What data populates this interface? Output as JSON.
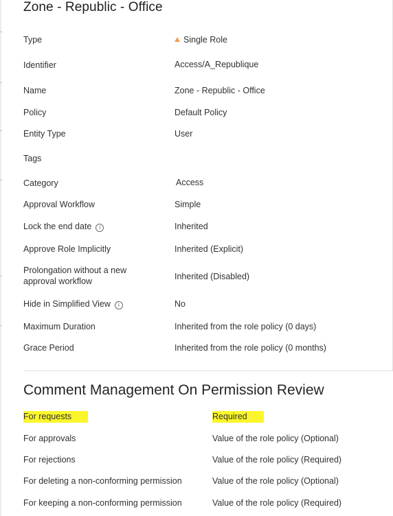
{
  "title": "Zone - Republic - Office",
  "properties": [
    {
      "label": "Type",
      "value": "Single Role"
    },
    {
      "label": "Identifier",
      "value": "Access/A_Republique"
    },
    {
      "label": "Name",
      "value": "Zone - Republic - Office"
    },
    {
      "label": "Policy",
      "value": "Default Policy"
    },
    {
      "label": "Entity Type",
      "value": "User"
    },
    {
      "label": "Tags",
      "value": ""
    },
    {
      "label": "Category",
      "value": "Access"
    },
    {
      "label": "Approval Workflow",
      "value": "Simple"
    },
    {
      "label": "Lock the end date",
      "value": "Inherited"
    },
    {
      "label": "Approve Role Implicitly",
      "value": "Inherited (Explicit)"
    },
    {
      "label": "Prolongation without a new approval workflow",
      "value": "Inherited (Disabled)"
    },
    {
      "label": "Hide in Simplified View",
      "value": "No"
    },
    {
      "label": "Maximum Duration",
      "value": "Inherited from the role policy (0 days)"
    },
    {
      "label": "Grace Period",
      "value": "Inherited from the role policy (0 months)"
    }
  ],
  "comments": {
    "title": "Comment Management On Permission Review",
    "rows": [
      {
        "label": "For requests",
        "value": "Required"
      },
      {
        "label": "For approvals",
        "value": "Value of the role policy (Optional)"
      },
      {
        "label": "For rejections",
        "value": "Value of the role policy (Required)"
      },
      {
        "label": "For deleting a non-conforming permission",
        "value": "Value of the role policy (Optional)"
      },
      {
        "label": "For keeping a non-conforming permission",
        "value": "Value of the role policy (Required)"
      }
    ]
  },
  "colors": {
    "highlight": "#fbf62c",
    "warning_icon": "#f0a050"
  },
  "icons": {
    "type_icon": "warning-triangle-icon",
    "info_icon": "info-circle-icon"
  }
}
